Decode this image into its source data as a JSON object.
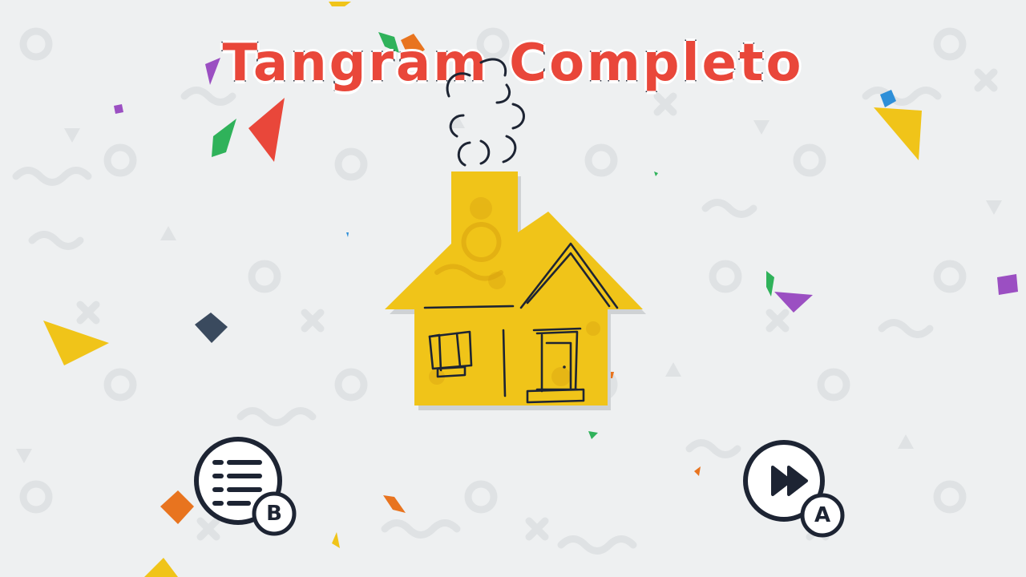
{
  "title": "Tangram Completo",
  "colors": {
    "background": "#eef0f1",
    "title_fill": "#e9473a",
    "title_outline": "#232a3a",
    "house_fill": "#f0c419",
    "ink": "#1d2433"
  },
  "buttons": {
    "menu": {
      "icon": "menu-list-icon",
      "key_label": "B"
    },
    "next": {
      "icon": "fast-forward-icon",
      "key_label": "A"
    }
  }
}
